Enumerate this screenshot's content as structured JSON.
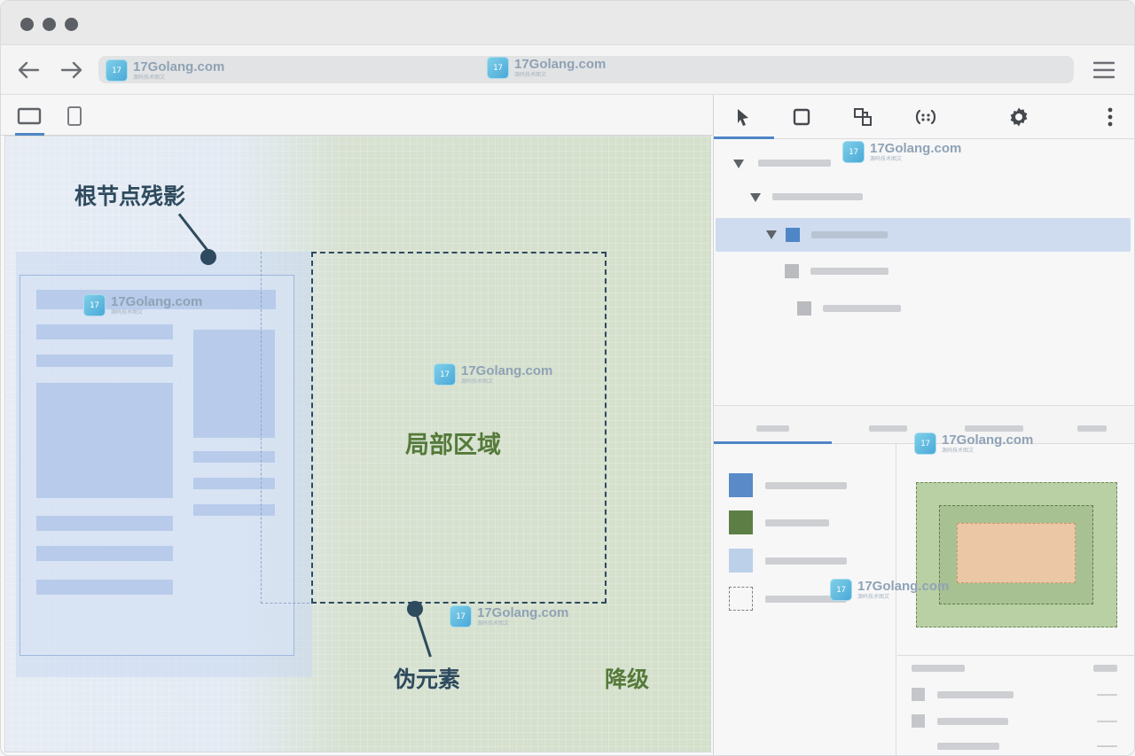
{
  "labels": {
    "root_ghost": "根节点残影",
    "local_area": "局部区域",
    "pseudo_element": "伪元素",
    "degrade": "降级"
  },
  "watermark": {
    "text": "17Golang.com",
    "subtext": "源码技术图文"
  },
  "icons": {
    "back": "arrow-left-icon",
    "forward": "arrow-right-icon",
    "menu": "hamburger-menu-icon",
    "desktop_view": "desktop-icon",
    "mobile_view": "mobile-icon",
    "select_element": "cursor-icon",
    "inspect_box": "square-icon",
    "device_toggle": "layers-icon",
    "variables": "variables-icon",
    "settings": "gear-icon",
    "more": "more-vertical-icon"
  },
  "colors": {
    "accent": "#4f86c6",
    "callout": "#2e4a5e",
    "local_area_text": "#557a3a",
    "swatch_blue": "#5a8ac8",
    "swatch_green": "#5d7f45",
    "swatch_lightblue": "#bcd0ea"
  }
}
